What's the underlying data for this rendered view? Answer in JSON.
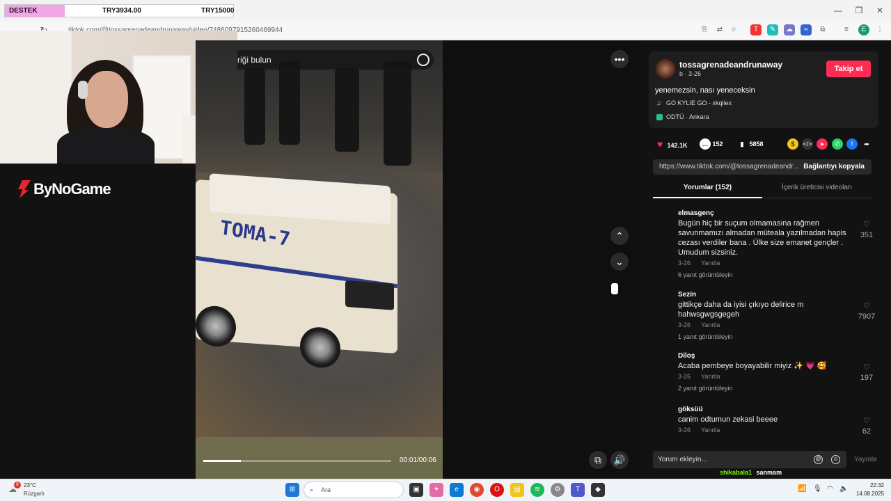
{
  "browser": {
    "url": "tiktok.com/@tossagrenadeandrunaway/video/7486097915260469944"
  },
  "donation": {
    "label": "DESTEK",
    "current": "TRY3934.00",
    "goal": "TRY15000",
    "progress_fraction": 0.262
  },
  "brand": {
    "logo_text": "ByNoGame"
  },
  "video": {
    "search_placeholder": "riği bulun",
    "sign_text": "TOMA-7",
    "time": "00:01/00:06",
    "progress_fraction": 0.2
  },
  "post": {
    "username": "tossagrenadeandrunaway",
    "meta": "b · 3-26",
    "follow_label": "Takip et",
    "caption": "yenemezsin, nası yeneceksin",
    "music": "GO KYLIE GO - xkqliex",
    "location": "ODTÜ · Ankara",
    "likes": "142.1K",
    "comments": "152",
    "saves": "5858",
    "link": "https://www.tiktok.com/@tossagrenadeandr...",
    "copy_label": "Bağlantıyı kopyala"
  },
  "tabs": {
    "comments": "Yorumlar (152)",
    "creator_videos": "İçerik üreticisi videoları"
  },
  "comments": [
    {
      "name": "elmasgenç",
      "text": "Bugün hiç bir suçum olmamasına rağmen savunmamızı almadan müteala yazılmadan hapis cezası verdiler bana . Ülke size emanet gençler . Umudum sizsiniz.",
      "date": "3-26",
      "reply": "Yanıtla",
      "more": "6 yanıt görüntüleyin",
      "likes": "351",
      "color": "#5b6b4a"
    },
    {
      "name": "Sezin",
      "text": "gittikçe daha da iyisi çıkıyo delirice m hahwsgwgsgegeh",
      "date": "3-26",
      "reply": "Yanıtla",
      "more": "1 yanıt görüntüleyin",
      "likes": "7907",
      "color": "#7b5e6e"
    },
    {
      "name": "Diloş",
      "text": "Acaba pembeye boyayabilir miyiz ✨ 💗 🥰",
      "date": "3-26",
      "reply": "Yanıtla",
      "more": "2 yanıt görüntüleyin",
      "likes": "197",
      "color": "#a32a2a"
    },
    {
      "name": "göksüü",
      "text": "canim odtumun zekasi beeee",
      "date": "3-26",
      "reply": "Yanıtla",
      "more": "",
      "likes": "62",
      "color": "#8a7fa0"
    }
  ],
  "comment_input": {
    "placeholder": "Yorum ekleyin...",
    "publish": "Yayınla"
  },
  "chat": {
    "user": "shikabala1",
    "message": "sanmam"
  },
  "taskbar": {
    "weather_temp": "23°C",
    "weather_desc": "Rüzgarlı",
    "weather_badge": "6",
    "search_label": "Ara",
    "time": "22:32",
    "date": "14.08.2025"
  }
}
